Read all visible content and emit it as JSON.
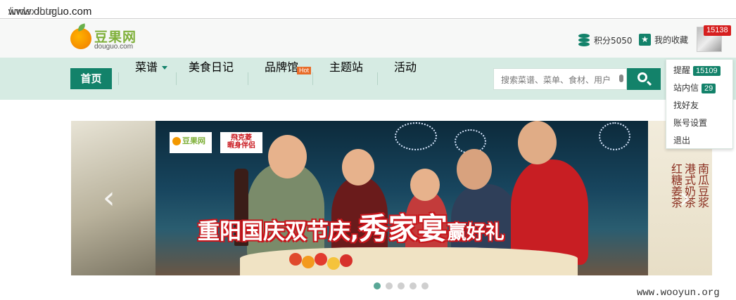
{
  "browser": {
    "url_host": "www.douguo.com",
    "url_path": "/index.html"
  },
  "header": {
    "logo_cn": "豆果网",
    "logo_en": "douguo.com",
    "points_label": "积分5050",
    "favorites_label": "我的收藏",
    "avatar_badge": "15138"
  },
  "nav": {
    "home": "首页",
    "recipes": "菜谱",
    "diary": "美食日记",
    "brands": "品牌馆",
    "hot_badge": "Hot",
    "topics": "主题站",
    "events": "活动"
  },
  "search": {
    "placeholder": "搜索菜谱、菜单、食材、用户"
  },
  "user_menu": {
    "items": [
      {
        "label": "提醒",
        "badge": "15109"
      },
      {
        "label": "站内信",
        "badge": "29"
      },
      {
        "label": "找好友",
        "badge": null
      },
      {
        "label": "账号设置",
        "badge": null
      },
      {
        "label": "退出",
        "badge": null
      }
    ]
  },
  "banner": {
    "logo_cn": "豆果网",
    "partner_line1": "飛克菱",
    "partner_line2": "暇身伴侣",
    "slogan_part1": "重阳国庆双节庆,",
    "slogan_part2": "秀家宴",
    "slogan_part3": "赢好礼",
    "right_text_col1": "南瓜豆浆",
    "right_text_col2": "港式奶茶",
    "right_text_col3": "红糖姜茶",
    "prev_arrow": "‹",
    "next_arrow": "›"
  },
  "carousel": {
    "dot_count": 5,
    "active_index": 0
  },
  "watermark": "www.wooyun.org"
}
